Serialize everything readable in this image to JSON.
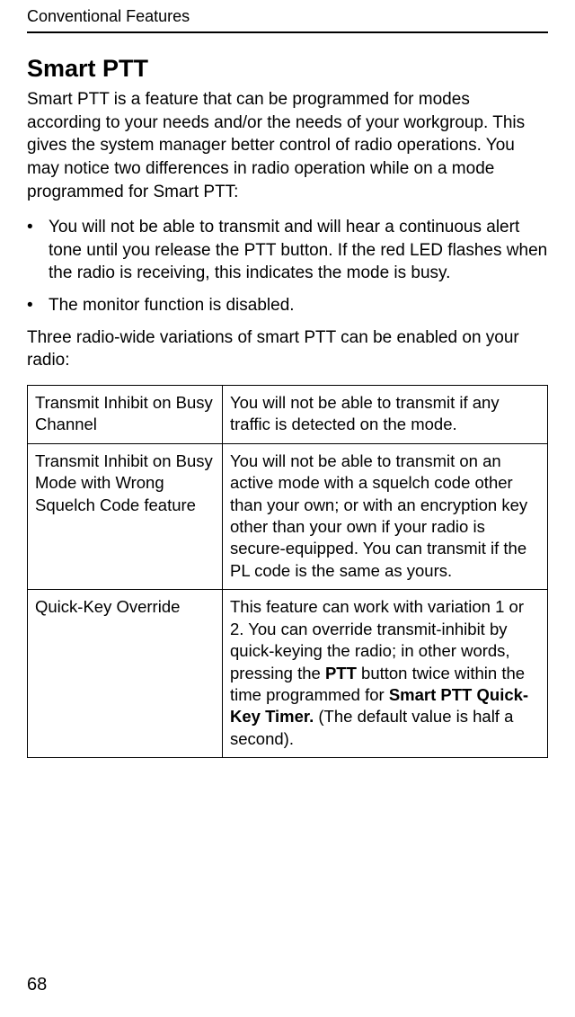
{
  "running_head": "Conventional Features",
  "section_title": "Smart PTT",
  "intro_paragraph": "Smart PTT is a feature that can be programmed for modes according to your needs and/or the needs of your workgroup. This gives the system manager better control of radio operations. You may notice two differences in radio operation while on a mode programmed for Smart PTT:",
  "bullets": [
    "You will not be able to transmit and will hear a continuous alert tone until you release the PTT button. If the red LED flashes when the radio is receiving, this indicates the mode is busy.",
    "The monitor function is disabled."
  ],
  "after_bullets": "Three radio-wide variations of smart PTT can be enabled on your radio:",
  "table_rows": [
    {
      "name": "Transmit Inhibit on Busy Channel",
      "desc_parts": [
        {
          "text": "You will not be able to transmit if any traffic is detected on the mode.",
          "bold": false
        }
      ]
    },
    {
      "name": "Transmit Inhibit on Busy Mode with Wrong Squelch Code feature",
      "desc_parts": [
        {
          "text": "You will not be able to transmit on an active mode with a squelch code other than your own; or with an encryption key other than your own if your radio is secure-equipped. You can transmit if the PL code is the same as yours.",
          "bold": false
        }
      ]
    },
    {
      "name": "Quick-Key Override",
      "desc_parts": [
        {
          "text": "This feature can work with variation 1 or 2. You can override transmit-inhibit by quick-keying the radio; in other words, pressing the ",
          "bold": false
        },
        {
          "text": "PTT",
          "bold": true
        },
        {
          "text": " button twice within the time programmed for ",
          "bold": false
        },
        {
          "text": "Smart PTT Quick-Key Timer.",
          "bold": true
        },
        {
          "text": " (The default value is half a second).",
          "bold": false
        }
      ]
    }
  ],
  "page_number": "68",
  "chart_data": null
}
